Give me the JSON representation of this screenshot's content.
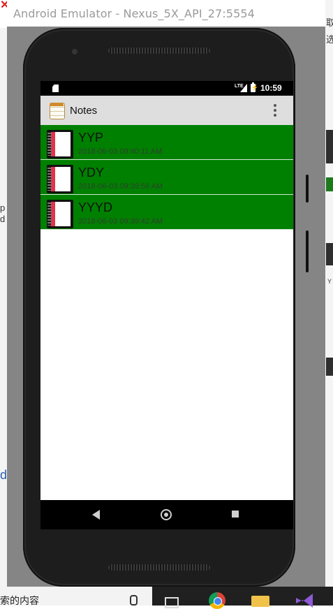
{
  "window": {
    "title": "Android Emulator - Nexus_5X_API_27:5554"
  },
  "status_bar": {
    "network": "LTE",
    "time": "10:59"
  },
  "app_bar": {
    "title": "Notes"
  },
  "notes": [
    {
      "title": "YYP",
      "timestamp": "2018-06-03 09:40:11 AM"
    },
    {
      "title": "YDY",
      "timestamp": "2018-06-03 09:39:56 AM"
    },
    {
      "title": "YYYD",
      "timestamp": "2018-06-03 09:39:42 AM"
    }
  ],
  "taskbar": {
    "search_text": "索的内容"
  },
  "background_fragments": {
    "f1": "p",
    "f2": "d",
    "f3": "d",
    "f4": "选",
    "f5": "取",
    "f6": "Y"
  },
  "colors": {
    "list_item_bg": "#008000",
    "app_bar_bg": "#dedede",
    "status_bar_bg": "#000000"
  },
  "icons": [
    "sd-card-icon",
    "signal-icon",
    "battery-charging-icon",
    "notes-app-icon",
    "overflow-menu-icon",
    "notebook-icon",
    "nav-back-icon",
    "nav-home-icon",
    "nav-recents-icon"
  ]
}
